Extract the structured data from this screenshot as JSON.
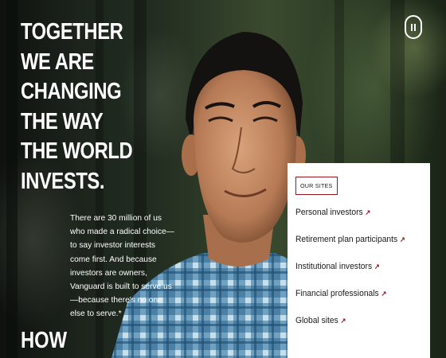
{
  "hero": {
    "headline": [
      "TOGETHER",
      "WE ARE",
      "CHANGING",
      "THE WAY",
      "THE WORLD",
      "INVESTS."
    ],
    "body": "There are 30 million of us who made a radical choice—to say investor interests come first. And because investors are owners, Vanguard is built to serve us—because there's no one else to serve.*",
    "how": "HOW",
    "pause_icon": "pause-icon"
  },
  "our_sites": {
    "heading": "OUR SITES",
    "links": [
      {
        "label": "Personal investors",
        "icon": "external-arrow-icon"
      },
      {
        "label": "Retirement plan participants",
        "icon": "external-arrow-icon"
      },
      {
        "label": "Institutional investors",
        "icon": "external-arrow-icon"
      },
      {
        "label": "Financial professionals",
        "icon": "external-arrow-icon"
      },
      {
        "label": "Global sites",
        "icon": "external-arrow-icon"
      }
    ],
    "accent": "#96151d"
  }
}
